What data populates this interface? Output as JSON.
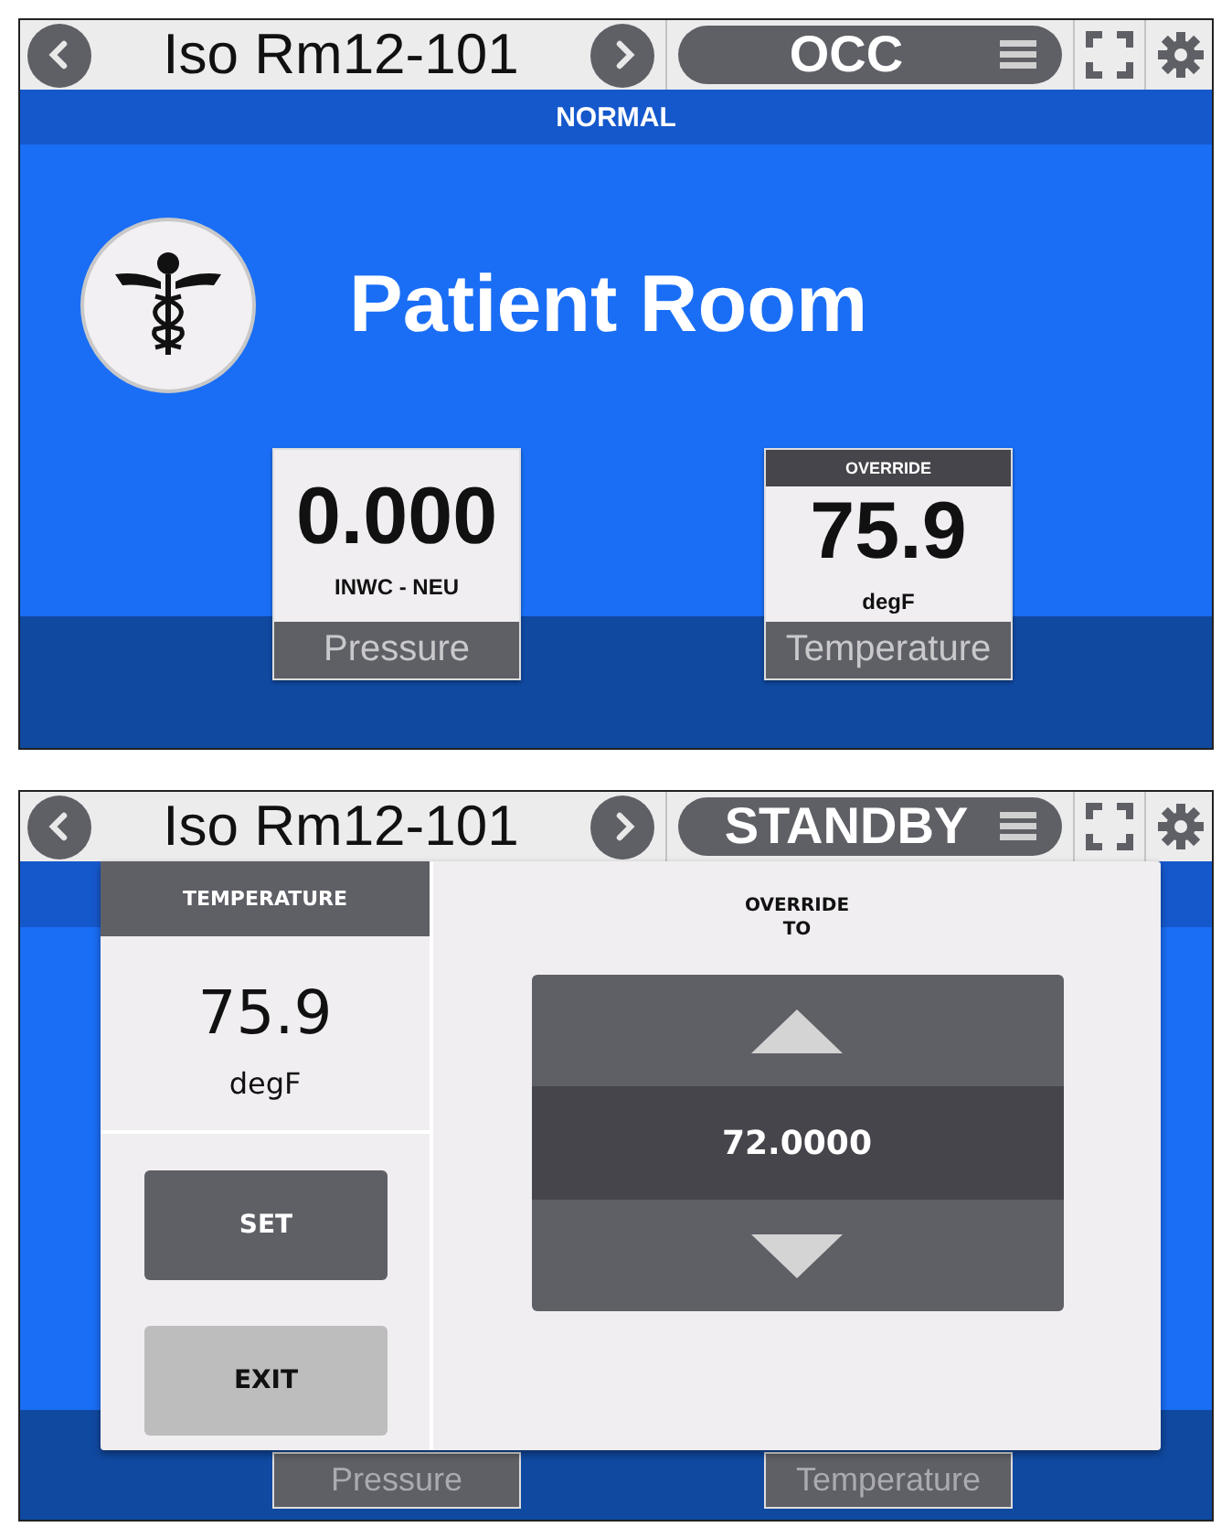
{
  "screens": [
    {
      "header": {
        "title": "Iso Rm12-101",
        "mode": "OCC"
      },
      "status": "NORMAL",
      "room": "Patient Room",
      "tiles": [
        {
          "value": "0.000",
          "unit": "INWC - NEU",
          "label": "Pressure"
        },
        {
          "badge": "OVERRIDE",
          "value": "75.9",
          "unit": "degF",
          "label": "Temperature"
        }
      ]
    },
    {
      "header": {
        "title": "Iso Rm12-101",
        "mode": "STANDBY"
      },
      "tiles": [
        {
          "label": "Pressure"
        },
        {
          "label": "Temperature"
        }
      ],
      "dialog": {
        "heading": "TEMPERATURE",
        "value": "75.9",
        "unit": "degF",
        "buttons": [
          {
            "label": "SET",
            "kind": "primary"
          },
          {
            "label": "EXIT",
            "kind": "secondary"
          }
        ],
        "spinner_label": "OVERRIDE\nTO",
        "spinner_value": "72.0000"
      }
    }
  ]
}
